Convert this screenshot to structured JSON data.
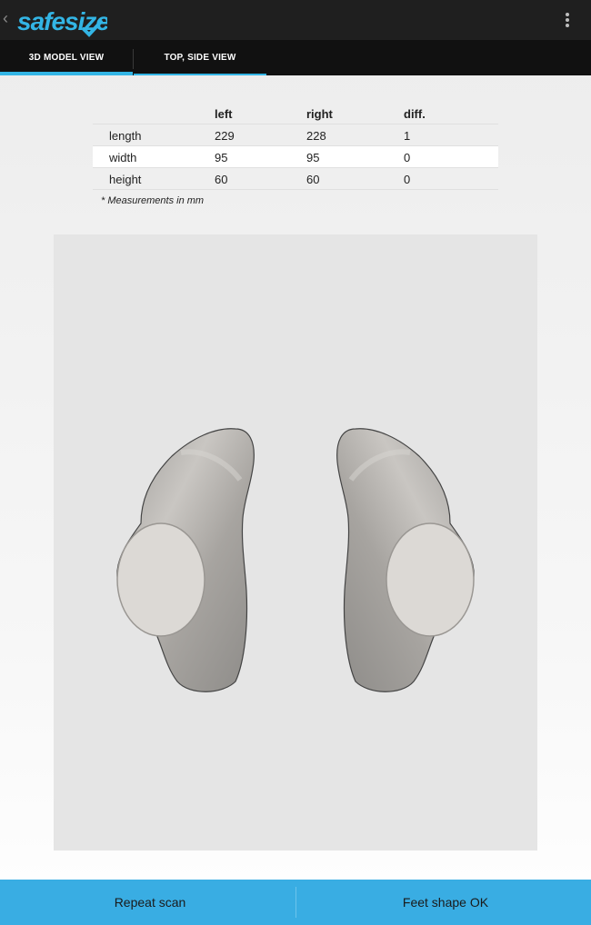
{
  "app": {
    "name": "safesize",
    "brand_color": "#33b5e5"
  },
  "tabs": [
    {
      "label": "3D MODEL VIEW",
      "selected": true
    },
    {
      "label": "TOP, SIDE VIEW",
      "selected": false
    }
  ],
  "table": {
    "headers": [
      "",
      "left",
      "right",
      "diff."
    ],
    "rows": [
      [
        "length",
        "229",
        "228",
        "1"
      ],
      [
        "width",
        "95",
        "95",
        "0"
      ],
      [
        "height",
        "60",
        "60",
        "0"
      ]
    ],
    "note": "* Measurements in mm"
  },
  "actions": {
    "repeat_label": "Repeat scan",
    "ok_label": "Feet shape OK"
  },
  "icons": {
    "back": "back-chevron-icon",
    "overflow": "overflow-menu-icon",
    "check": "checkmark-icon"
  }
}
